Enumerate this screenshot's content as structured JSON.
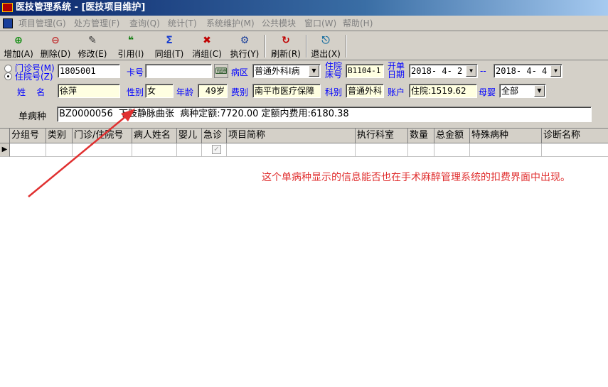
{
  "window": {
    "title": "医技管理系统 - [医技项目维护]"
  },
  "menu": {
    "items": [
      "项目管理(G)",
      "处方管理(F)",
      "查询(Q)",
      "统计(T)",
      "系统维护(M)",
      "公共模块",
      "窗口(W)",
      "帮助(H)"
    ]
  },
  "toolbar": {
    "buttons": [
      {
        "label": "增加(A)",
        "icon": "add-icon",
        "glyph": "⊕"
      },
      {
        "label": "删除(D)",
        "icon": "delete-icon",
        "glyph": "⊖"
      },
      {
        "label": "修改(E)",
        "icon": "edit-icon",
        "glyph": "✎"
      },
      {
        "label": "引用(I)",
        "icon": "quote-icon",
        "glyph": "❝"
      },
      {
        "label": "同组(T)",
        "icon": "sigma-icon",
        "glyph": "Σ"
      },
      {
        "label": "消组(C)",
        "icon": "ungroup-icon",
        "glyph": "✖"
      },
      {
        "label": "执行(Y)",
        "icon": "execute-icon",
        "glyph": "⚙"
      },
      {
        "label": "刷新(R)",
        "icon": "refresh-icon",
        "glyph": "↻"
      },
      {
        "label": "退出(X)",
        "icon": "exit-icon",
        "glyph": "⎋"
      }
    ]
  },
  "form": {
    "radio_outpatient": "门诊号(M)",
    "radio_inpatient": "住院号(Z)",
    "inpatient_no": "1805001",
    "card_label": "卡号",
    "card_value": "",
    "ward_label": "病区",
    "ward_value": "普通外科Ⅰ病",
    "bed_label": "住院床号",
    "bed_value": "B1104-1",
    "order_date_label": "开单日期",
    "date_from": "2018- 4- 2",
    "date_sep": "--",
    "date_to": "2018- 4- 4",
    "name_label": "姓    名",
    "name_value": "徐萍",
    "gender_label": "性别",
    "gender_value": "女",
    "age_label": "年龄",
    "age_value": "49岁",
    "fee_type_label": "费别",
    "fee_type_value": "南平市医疗保障",
    "dept_label": "科别",
    "dept_value": "普通外科",
    "account_label": "账户",
    "account_value": "住院:1519.62",
    "infant_label": "母婴",
    "infant_value": "全部",
    "single_disease_label": "单病种",
    "single_disease_value": "BZ0000056  下肢静脉曲张  病种定额:7720.00 定额内费用:6180.38"
  },
  "grid": {
    "columns": [
      "分组号",
      "类别",
      "门诊/住院号",
      "病人姓名",
      "婴儿",
      "急诊",
      "项目简称",
      "执行科室",
      "数量",
      "总金额",
      "特殊病种",
      "诊断名称"
    ]
  },
  "annotation": "这个单病种显示的信息能否也在手术麻醉管理系统的扣费界面中出现。",
  "colors": {
    "title_start": "#0a246a",
    "annotation": "#e03030",
    "label_blue": "#0000ff",
    "field_yellow": "#ffffe1"
  }
}
